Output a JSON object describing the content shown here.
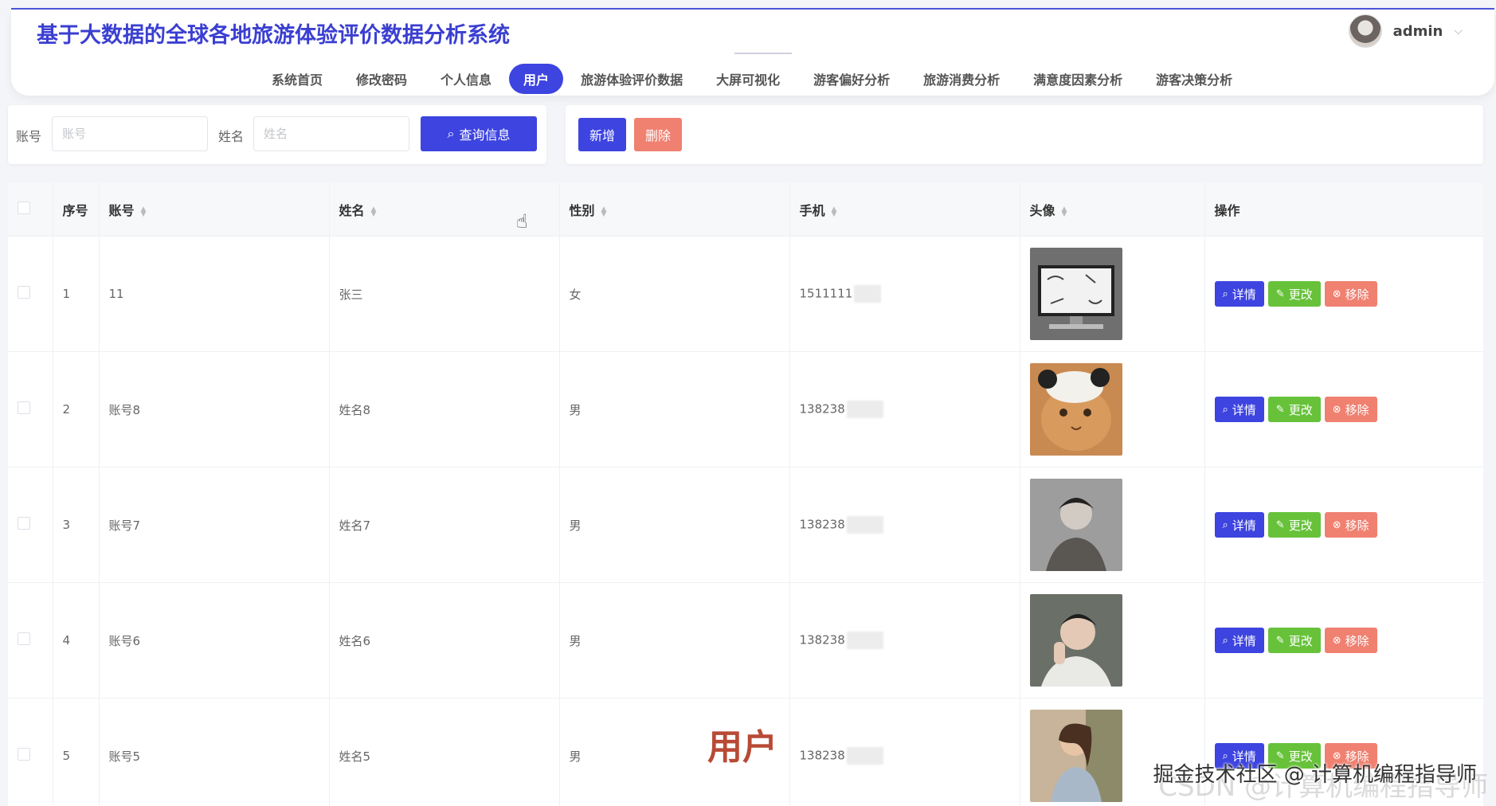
{
  "app": {
    "title": "基于大数据的全球各地旅游体验评价数据分析系统",
    "user": "admin",
    "accent": "#3d44e0"
  },
  "nav": {
    "items": [
      "系统首页",
      "修改密码",
      "个人信息",
      "用户",
      "旅游体验评价数据",
      "大屏可视化",
      "游客偏好分析",
      "旅游消费分析",
      "满意度因素分析",
      "游客决策分析"
    ],
    "active": "用户"
  },
  "search": {
    "account_label": "账号",
    "account_placeholder": "账号",
    "name_label": "姓名",
    "name_placeholder": "姓名",
    "query_label": "查询信息"
  },
  "actions": {
    "add_label": "新增",
    "delete_label": "删除"
  },
  "table": {
    "columns": [
      "序号",
      "账号",
      "姓名",
      "性别",
      "手机",
      "头像",
      "操作"
    ],
    "rows": [
      {
        "index": "1",
        "account": "11",
        "name": "张三",
        "gender": "女",
        "phone": "1511111"
      },
      {
        "index": "2",
        "account": "账号8",
        "name": "姓名8",
        "gender": "男",
        "phone": "138238"
      },
      {
        "index": "3",
        "account": "账号7",
        "name": "姓名7",
        "gender": "男",
        "phone": "138238"
      },
      {
        "index": "4",
        "account": "账号6",
        "name": "姓名6",
        "gender": "男",
        "phone": "138238"
      },
      {
        "index": "5",
        "account": "账号5",
        "name": "姓名5",
        "gender": "男",
        "phone": "138238"
      }
    ],
    "op_labels": {
      "detail": "详情",
      "edit": "更改",
      "remove": "移除"
    }
  },
  "overlay": {
    "label": "用户",
    "watermark": "掘金技术社区 @ 计算机编程指导师",
    "watermark_faint": "CSDN @计算机编程指导师"
  }
}
